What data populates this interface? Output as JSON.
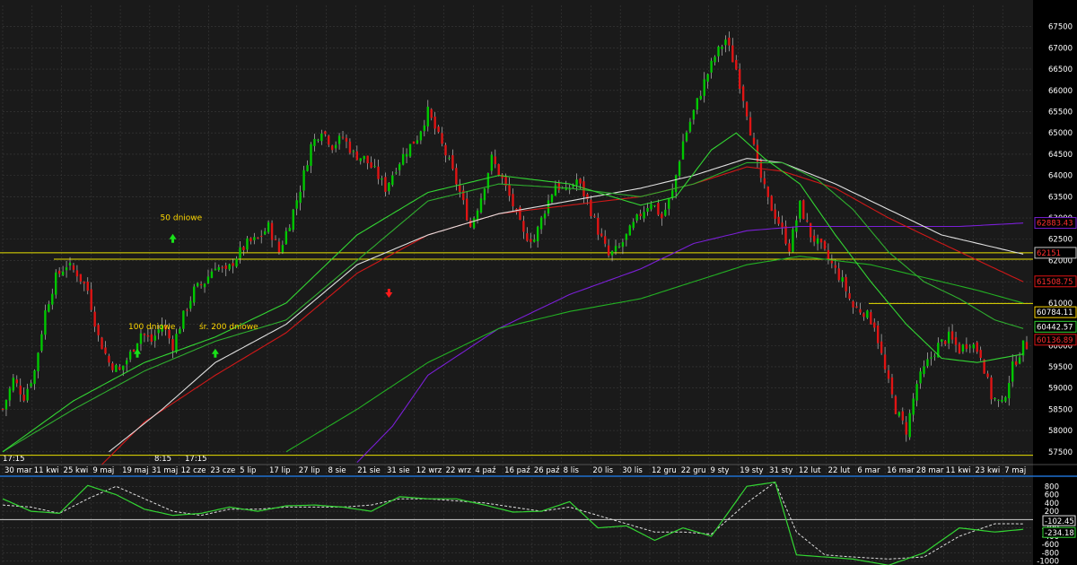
{
  "colors": {
    "background": "#1a1a1a",
    "grid": "#3a3a3a",
    "bull": "#00c800",
    "bear": "#e01414",
    "sma20": "#33d633",
    "sma50": "#2fae2f",
    "sma100": "#e0e0e0",
    "ema100": "#d01818",
    "sma200": "#23b023",
    "sma200b": "#7a1fd6",
    "hline": "#e8e000",
    "osc": "#33d633",
    "signal": "#e0e0e0",
    "divider": "#1e6fd0",
    "arrow_up": "#19e019",
    "arrow_down": "#ff1a1a"
  },
  "chart_data": [
    {
      "type": "candlestick",
      "y_ticks": [
        "67500",
        "67000",
        "66500",
        "66000",
        "65500",
        "65000",
        "64500",
        "64000",
        "63500",
        "63000",
        "62500",
        "62000",
        "61500",
        "61000",
        "60500",
        "60000",
        "59500",
        "59000",
        "58500",
        "58000",
        "57500"
      ],
      "ylim": [
        57200,
        68000
      ],
      "x_labels": [
        "30 mar",
        "11 kwi",
        "25 kwi",
        "9 maj",
        "19 maj",
        "31 maj",
        "12 cze",
        "23 cze",
        "5 lip",
        "17 lip",
        "27 lip",
        "8 sie",
        "21 sie",
        "31 sie",
        "12 wrz",
        "22 wrz",
        "4 paź",
        "16 paź",
        "26 paź",
        "8 lis",
        "20 lis",
        "30 lis",
        "12 gru",
        "22 gru",
        "9 sty",
        "19 sty",
        "31 sty",
        "12 lut",
        "22 lut",
        "6 mar",
        "16 mar",
        "28 mar",
        "11 kwi",
        "23 kwi",
        "7 maj"
      ],
      "time_labels": [
        "17:15",
        "8:15",
        "17:15"
      ],
      "price_tags": [
        {
          "text": "62883.43",
          "value": 62883,
          "color": "#7a1fd6",
          "text_color": "#ff3030"
        },
        {
          "text": "62151",
          "value": 62180,
          "color": "#c8c8c8",
          "text_color": "#ff3030"
        },
        {
          "text": "61508.75",
          "value": 61508,
          "color": "#e01414",
          "text_color": "#ff3030"
        },
        {
          "text": "60784.11",
          "value": 60784,
          "color": "#ffd800",
          "text_color": "#ffffff"
        },
        {
          "text": "60442.57",
          "value": 60442,
          "color": "#33d633",
          "text_color": "#ffffff"
        },
        {
          "text": "60136.89",
          "value": 60136,
          "color": "#e01414",
          "text_color": "#ff3030"
        }
      ],
      "horizontal_levels": [
        62180,
        62030,
        60990,
        57420
      ],
      "annotations": [
        {
          "text": "50 dniowe",
          "x_index": 47,
          "value": 62950
        },
        {
          "text": "100 dniowe",
          "x_index": 38,
          "value": 60390
        },
        {
          "text": "śr. 200 dniowe",
          "x_index": 58,
          "value": 60390
        }
      ],
      "up_arrows": [
        {
          "x_index": 48,
          "value": 62500
        },
        {
          "x_index": 38,
          "value": 59800
        },
        {
          "x_index": 60,
          "value": 59800
        }
      ],
      "down_arrows": [
        {
          "x_index": 109,
          "value": 61250
        }
      ],
      "close_path": [
        [
          0,
          58500
        ],
        [
          3,
          59200
        ],
        [
          6,
          58800
        ],
        [
          9,
          59400
        ],
        [
          12,
          60800
        ],
        [
          15,
          61600
        ],
        [
          18,
          61900
        ],
        [
          21,
          61700
        ],
        [
          24,
          61300
        ],
        [
          27,
          60200
        ],
        [
          30,
          59600
        ],
        [
          33,
          59400
        ],
        [
          36,
          59800
        ],
        [
          39,
          60300
        ],
        [
          42,
          60100
        ],
        [
          45,
          60500
        ],
        [
          48,
          60000
        ],
        [
          51,
          60700
        ],
        [
          54,
          61300
        ],
        [
          57,
          61500
        ],
        [
          60,
          61900
        ],
        [
          63,
          61700
        ],
        [
          66,
          62100
        ],
        [
          69,
          62400
        ],
        [
          72,
          62500
        ],
        [
          75,
          62800
        ],
        [
          78,
          62200
        ],
        [
          81,
          62900
        ],
        [
          84,
          63700
        ],
        [
          87,
          64700
        ],
        [
          90,
          65100
        ],
        [
          93,
          64700
        ],
        [
          96,
          64900
        ],
        [
          99,
          64500
        ],
        [
          102,
          64400
        ],
        [
          105,
          64100
        ],
        [
          108,
          63700
        ],
        [
          111,
          64200
        ],
        [
          114,
          64600
        ],
        [
          117,
          64900
        ],
        [
          120,
          65500
        ],
        [
          123,
          64900
        ],
        [
          126,
          64300
        ],
        [
          129,
          63600
        ],
        [
          132,
          62800
        ],
        [
          135,
          63500
        ],
        [
          138,
          64400
        ],
        [
          141,
          63900
        ],
        [
          144,
          63300
        ],
        [
          147,
          62600
        ],
        [
          150,
          62500
        ],
        [
          153,
          63200
        ],
        [
          156,
          63800
        ],
        [
          159,
          63600
        ],
        [
          162,
          63900
        ],
        [
          165,
          63400
        ],
        [
          168,
          62700
        ],
        [
          171,
          62100
        ],
        [
          174,
          62300
        ],
        [
          177,
          62700
        ],
        [
          180,
          63100
        ],
        [
          183,
          63400
        ],
        [
          186,
          63000
        ],
        [
          189,
          63600
        ],
        [
          192,
          64800
        ],
        [
          195,
          65500
        ],
        [
          198,
          66200
        ],
        [
          201,
          66800
        ],
        [
          204,
          67200
        ],
        [
          207,
          66500
        ],
        [
          210,
          65500
        ],
        [
          213,
          64200
        ],
        [
          216,
          63400
        ],
        [
          219,
          62900
        ],
        [
          222,
          62300
        ],
        [
          225,
          63300
        ],
        [
          228,
          62600
        ],
        [
          231,
          62300
        ],
        [
          234,
          61900
        ],
        [
          237,
          61500
        ],
        [
          240,
          60900
        ],
        [
          243,
          60800
        ],
        [
          246,
          60500
        ],
        [
          249,
          59400
        ],
        [
          252,
          58500
        ],
        [
          255,
          58000
        ],
        [
          258,
          59100
        ],
        [
          261,
          59600
        ],
        [
          264,
          60000
        ],
        [
          267,
          60200
        ],
        [
          270,
          59900
        ],
        [
          273,
          60100
        ],
        [
          276,
          59800
        ],
        [
          279,
          58800
        ],
        [
          282,
          58600
        ],
        [
          285,
          59500
        ],
        [
          288,
          60000
        ]
      ],
      "sma20_path": [
        [
          0,
          57500
        ],
        [
          20,
          58700
        ],
        [
          40,
          59600
        ],
        [
          60,
          60200
        ],
        [
          80,
          61000
        ],
        [
          100,
          62600
        ],
        [
          120,
          63600
        ],
        [
          140,
          64000
        ],
        [
          160,
          63800
        ],
        [
          180,
          63300
        ],
        [
          190,
          63500
        ],
        [
          200,
          64600
        ],
        [
          207,
          65000
        ],
        [
          215,
          64400
        ],
        [
          225,
          63800
        ],
        [
          235,
          62600
        ],
        [
          245,
          61500
        ],
        [
          255,
          60500
        ],
        [
          265,
          59700
        ],
        [
          275,
          59600
        ],
        [
          288,
          59800
        ]
      ],
      "sma50_path": [
        [
          0,
          57500
        ],
        [
          20,
          58500
        ],
        [
          40,
          59400
        ],
        [
          60,
          60100
        ],
        [
          80,
          60600
        ],
        [
          100,
          62000
        ],
        [
          120,
          63400
        ],
        [
          140,
          63800
        ],
        [
          160,
          63700
        ],
        [
          180,
          63500
        ],
        [
          195,
          63800
        ],
        [
          210,
          64300
        ],
        [
          220,
          64300
        ],
        [
          230,
          63900
        ],
        [
          240,
          63200
        ],
        [
          250,
          62200
        ],
        [
          260,
          61500
        ],
        [
          270,
          61100
        ],
        [
          280,
          60600
        ],
        [
          288,
          60400
        ]
      ],
      "sma100_path": [
        [
          30,
          57500
        ],
        [
          45,
          58500
        ],
        [
          60,
          59600
        ],
        [
          80,
          60500
        ],
        [
          100,
          61900
        ],
        [
          120,
          62600
        ],
        [
          140,
          63100
        ],
        [
          160,
          63400
        ],
        [
          180,
          63700
        ],
        [
          195,
          64000
        ],
        [
          210,
          64400
        ],
        [
          220,
          64300
        ],
        [
          235,
          63800
        ],
        [
          250,
          63200
        ],
        [
          265,
          62600
        ],
        [
          288,
          62150
        ]
      ],
      "ema100_path": [
        [
          28,
          57200
        ],
        [
          40,
          58200
        ],
        [
          60,
          59300
        ],
        [
          80,
          60300
        ],
        [
          100,
          61700
        ],
        [
          120,
          62600
        ],
        [
          140,
          63100
        ],
        [
          160,
          63300
        ],
        [
          180,
          63500
        ],
        [
          195,
          63800
        ],
        [
          210,
          64200
        ],
        [
          220,
          64100
        ],
        [
          235,
          63700
        ],
        [
          250,
          63000
        ],
        [
          265,
          62400
        ],
        [
          288,
          61500
        ]
      ],
      "sma200a_path": [
        [
          80,
          57500
        ],
        [
          100,
          58500
        ],
        [
          120,
          59600
        ],
        [
          140,
          60400
        ],
        [
          160,
          60800
        ],
        [
          180,
          61100
        ],
        [
          195,
          61500
        ],
        [
          210,
          61900
        ],
        [
          225,
          62100
        ],
        [
          245,
          61900
        ],
        [
          260,
          61600
        ],
        [
          275,
          61300
        ],
        [
          288,
          61000
        ]
      ],
      "sma200b_path": [
        [
          100,
          57250
        ],
        [
          110,
          58100
        ],
        [
          120,
          59300
        ],
        [
          140,
          60400
        ],
        [
          160,
          61200
        ],
        [
          180,
          61800
        ],
        [
          195,
          62400
        ],
        [
          210,
          62700
        ],
        [
          225,
          62800
        ],
        [
          250,
          62800
        ],
        [
          270,
          62800
        ],
        [
          288,
          62880
        ]
      ],
      "candle_count": 290
    },
    {
      "type": "line",
      "y_ticks": [
        "800",
        "600",
        "400",
        "200",
        "0",
        "-200",
        "-400",
        "-600",
        "-800",
        "-1000"
      ],
      "ylim": [
        -1050,
        1000
      ],
      "zero": 0,
      "values_tags": [
        {
          "text": "-102.45",
          "value": -102,
          "color": "#e0e0e0"
        },
        {
          "text": "-234.18",
          "value": -234,
          "color": "#33d633"
        }
      ],
      "osc_path": [
        [
          0,
          500
        ],
        [
          8,
          200
        ],
        [
          16,
          150
        ],
        [
          24,
          820
        ],
        [
          32,
          600
        ],
        [
          40,
          250
        ],
        [
          48,
          100
        ],
        [
          56,
          150
        ],
        [
          64,
          300
        ],
        [
          72,
          200
        ],
        [
          80,
          330
        ],
        [
          88,
          350
        ],
        [
          96,
          300
        ],
        [
          104,
          200
        ],
        [
          112,
          550
        ],
        [
          120,
          500
        ],
        [
          128,
          500
        ],
        [
          136,
          350
        ],
        [
          144,
          180
        ],
        [
          152,
          200
        ],
        [
          160,
          430
        ],
        [
          168,
          -200
        ],
        [
          176,
          -150
        ],
        [
          184,
          -500
        ],
        [
          192,
          -200
        ],
        [
          200,
          -400
        ],
        [
          210,
          800
        ],
        [
          218,
          900
        ],
        [
          224,
          -850
        ],
        [
          232,
          -900
        ],
        [
          240,
          -950
        ],
        [
          250,
          -1100
        ],
        [
          260,
          -800
        ],
        [
          270,
          -200
        ],
        [
          280,
          -300
        ],
        [
          288,
          -234
        ]
      ],
      "signal_path": [
        [
          0,
          350
        ],
        [
          8,
          300
        ],
        [
          16,
          150
        ],
        [
          24,
          500
        ],
        [
          32,
          800
        ],
        [
          40,
          500
        ],
        [
          48,
          200
        ],
        [
          56,
          100
        ],
        [
          64,
          250
        ],
        [
          72,
          250
        ],
        [
          80,
          300
        ],
        [
          88,
          300
        ],
        [
          96,
          300
        ],
        [
          104,
          350
        ],
        [
          112,
          500
        ],
        [
          120,
          500
        ],
        [
          128,
          450
        ],
        [
          136,
          400
        ],
        [
          144,
          300
        ],
        [
          152,
          200
        ],
        [
          160,
          300
        ],
        [
          168,
          100
        ],
        [
          176,
          -100
        ],
        [
          184,
          -300
        ],
        [
          192,
          -300
        ],
        [
          200,
          -350
        ],
        [
          210,
          400
        ],
        [
          218,
          900
        ],
        [
          224,
          -300
        ],
        [
          232,
          -850
        ],
        [
          240,
          -900
        ],
        [
          250,
          -950
        ],
        [
          260,
          -900
        ],
        [
          270,
          -400
        ],
        [
          280,
          -100
        ],
        [
          288,
          -102
        ]
      ]
    }
  ]
}
